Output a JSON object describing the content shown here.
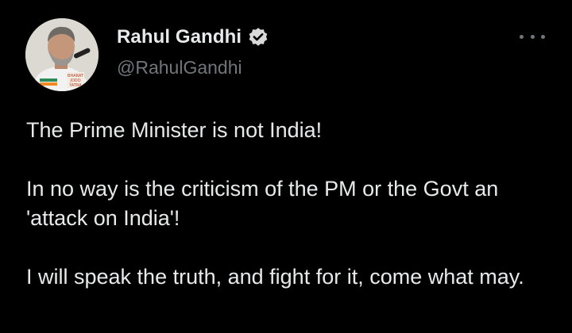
{
  "author": {
    "display_name": "Rahul Gandhi",
    "handle": "@RahulGandhi",
    "verified": true,
    "avatar_text": [
      "BHARAT",
      "JODO",
      "YATRA"
    ]
  },
  "tweet": {
    "paragraphs": [
      "The Prime Minister is not India!",
      "In no way is the criticism of the PM or the Govt an 'attack on India'!",
      "I will speak the truth, and fight for it, come what may."
    ]
  },
  "icons": {
    "verified": "verified-badge-icon",
    "more": "more-options-icon"
  },
  "colors": {
    "background": "#000000",
    "text": "#e7e9ea",
    "secondary_text": "#71767b",
    "verified_badge": "#d9d9d9"
  }
}
